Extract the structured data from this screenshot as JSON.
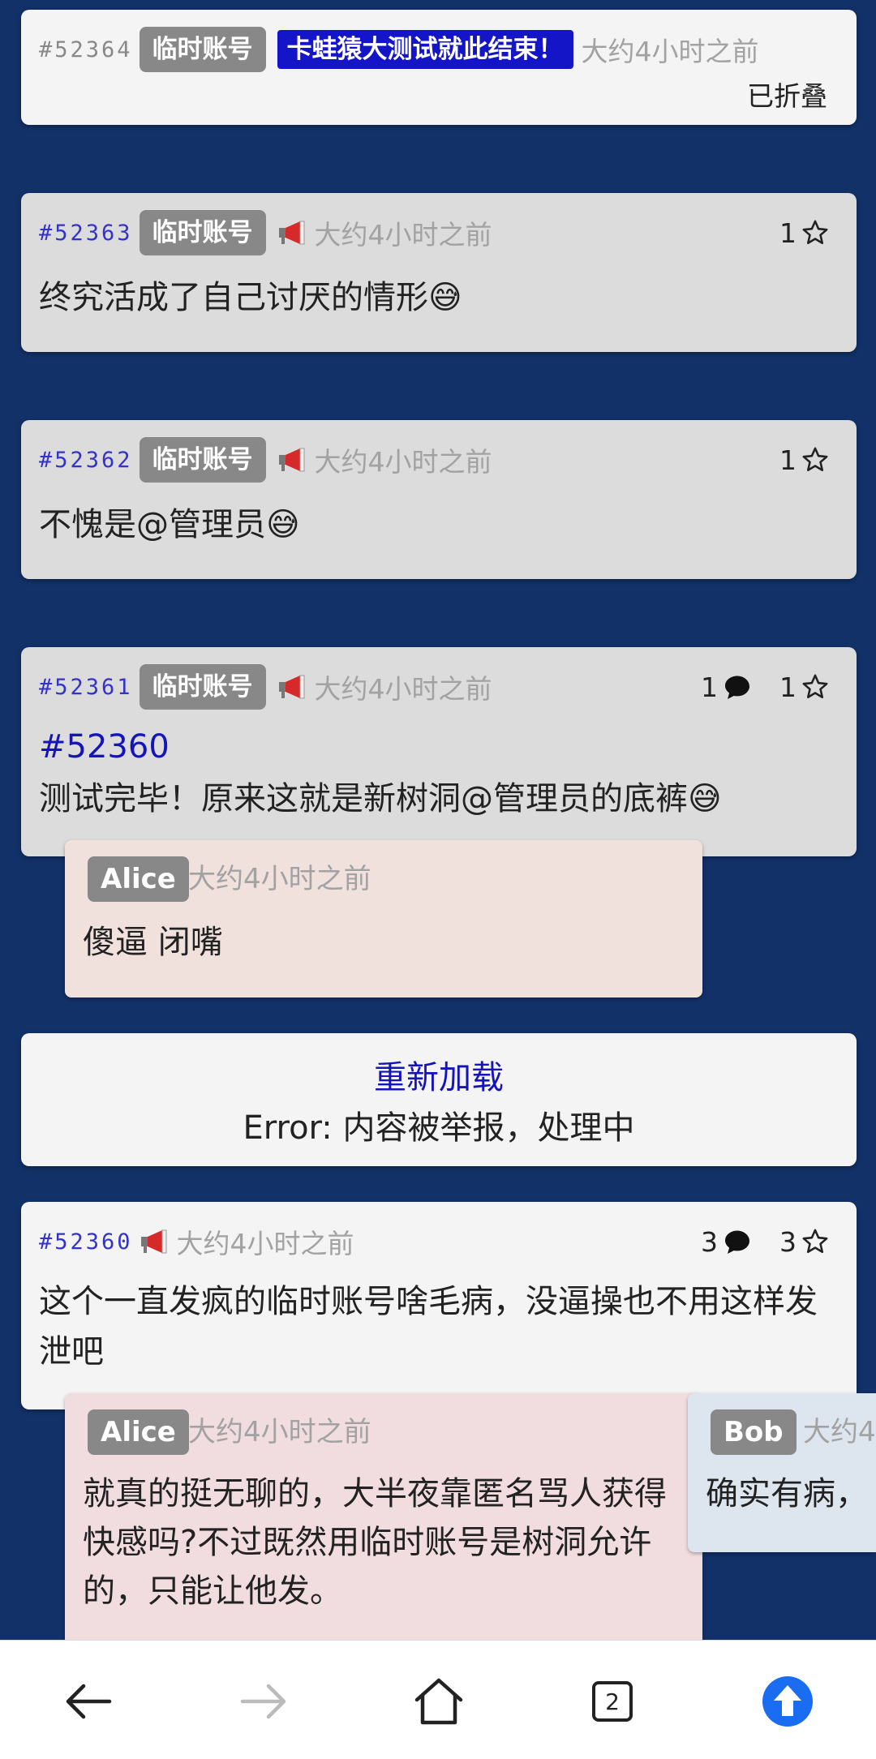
{
  "posts": [
    {
      "id": "#52364",
      "badge": "临时账号",
      "notice": "卡蛙猿大测试就此结束！",
      "time": "大约4小时之前",
      "status": "已折叠"
    },
    {
      "id": "#52363",
      "badge": "临时账号",
      "time": "大约4小时之前",
      "stars": "1",
      "text": "终究活成了自己讨厌的情形😅"
    },
    {
      "id": "#52362",
      "badge": "临时账号",
      "time": "大约4小时之前",
      "stars": "1",
      "text": "不愧是@管理员😅"
    },
    {
      "id": "#52361",
      "badge": "临时账号",
      "time": "大约4小时之前",
      "comments": "1",
      "stars": "1",
      "ref": "#52360",
      "text": "测试完毕！原来这就是新树洞@管理员的底裤😅",
      "replies": [
        {
          "name": "Alice",
          "time": "大约4小时之前",
          "text": "傻逼 闭嘴"
        }
      ]
    }
  ],
  "error_card": {
    "reload": "重新加载",
    "message": "Error: 内容被举报，处理中"
  },
  "post_52360": {
    "id": "#52360",
    "time": "大约4小时之前",
    "comments": "3",
    "stars": "3",
    "text": "这个一直发疯的临时账号啥毛病，没逼操也不用这样发泄吧",
    "replies": [
      {
        "name": "Alice",
        "time": "大约4小时之前",
        "text": "就真的挺无聊的，大半夜靠匿名骂人获得快感吗?不过既然用临时账号是树洞允许的，只能让他发。"
      },
      {
        "name": "Bob",
        "time": "大约4",
        "text": "确实有病，"
      }
    ]
  },
  "browser_bar": {
    "tab_count": "2",
    "accent": "#1a6cf0"
  }
}
